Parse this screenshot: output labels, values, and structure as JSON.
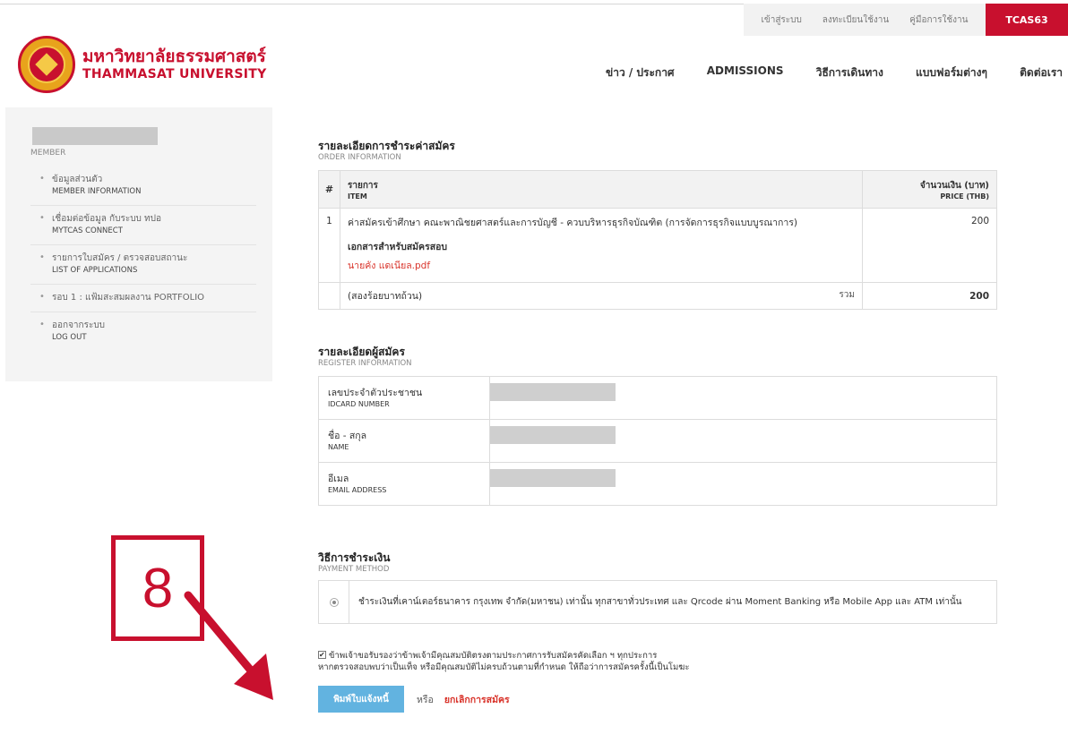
{
  "util": {
    "login": "เข้าสู่ระบบ",
    "register": "ลงทะเบียนใช้งาน",
    "manual": "คู่มือการใช้งาน",
    "tcas": "TCAS63"
  },
  "logo": {
    "th": "มหาวิทยาลัยธรรมศาสตร์",
    "en": "THAMMASAT UNIVERSITY"
  },
  "nav": [
    "ข่าว / ประกาศ",
    "ADMISSIONS",
    "วิธีการเดินทาง",
    "แบบฟอร์มต่างๆ",
    "ติดต่อเรา"
  ],
  "sidebar": {
    "member": "MEMBER",
    "items": [
      {
        "th": "ข้อมูลส่วนตัว",
        "en": "MEMBER INFORMATION"
      },
      {
        "th": "เชื่อมต่อข้อมูล กับระบบ ทปอ",
        "en": "MYTCAS CONNECT"
      },
      {
        "th": "รายการใบสมัคร / ตรวจสอบสถานะ",
        "en": "LIST OF APPLICATIONS"
      },
      {
        "th": "รอบ 1 : แฟ้มสะสมผลงาน PORTFOLIO",
        "en": ""
      },
      {
        "th": "ออกจากระบบ",
        "en": "LOG OUT"
      }
    ]
  },
  "order": {
    "title": "รายละเอียดการชำระค่าสมัคร",
    "subtitle": "ORDER INFORMATION",
    "col_num": "#",
    "col_item_th": "รายการ",
    "col_item_en": "ITEM",
    "col_price_th": "จำนวนเงิน (บาท)",
    "col_price_en": "PRICE (THB)",
    "row_num": "1",
    "row_item": "ค่าสมัครเข้าศึกษา คณะพาณิชยศาสตร์และการบัญชี - ควบบริหารธุรกิจบัณฑิต (การจัดการธุรกิจแบบบูรณาการ)",
    "doc_title": "เอกสารสำหรับสมัครสอบ",
    "doc_file": "นายคัง แดเนียล.pdf",
    "row_price": "200",
    "total_words": "(สองร้อยบาทถ้วน)",
    "total_label": "รวม",
    "total_value": "200"
  },
  "register": {
    "title": "รายละเอียดผู้สมัคร",
    "subtitle": "REGISTER INFORMATION",
    "rows": [
      {
        "th": "เลขประจำตัวประชาชน",
        "en": "IDCARD NUMBER"
      },
      {
        "th": "ชื่อ - สกุล",
        "en": "NAME"
      },
      {
        "th": "อีเมล",
        "en": "EMAIL ADDRESS"
      }
    ]
  },
  "payment": {
    "title": "วิธีการชำระเงิน",
    "subtitle": "PAYMENT METHOD",
    "option": "ชำระเงินที่เคาน์เตอร์ธนาคาร กรุงเทพ จำกัด(มหาชน) เท่านั้น ทุกสาขาทั่วประเทศ และ Qrcode ผ่าน Moment Banking หรือ Mobile App และ ATM เท่านั้น"
  },
  "consent": {
    "line1": "ข้าพเจ้าขอรับรองว่าข้าพเจ้ามีคุณสมบัติตรงตามประกาศการรับสมัครคัดเลือก ฯ ทุกประการ",
    "line2": "หากตรวจสอบพบว่าเป็นเท็จ หรือมีคุณสมบัติไม่ครบถ้วนตามที่กำหนด ให้ถือว่าการสมัครครั้งนี้เป็นโมฆะ"
  },
  "actions": {
    "print": "พิมพ์ใบแจ้งหนี้",
    "or": "หรือ",
    "cancel": "ยกเลิกการสมัคร"
  },
  "annotation": {
    "step": "8",
    "color": "#c8102e"
  }
}
